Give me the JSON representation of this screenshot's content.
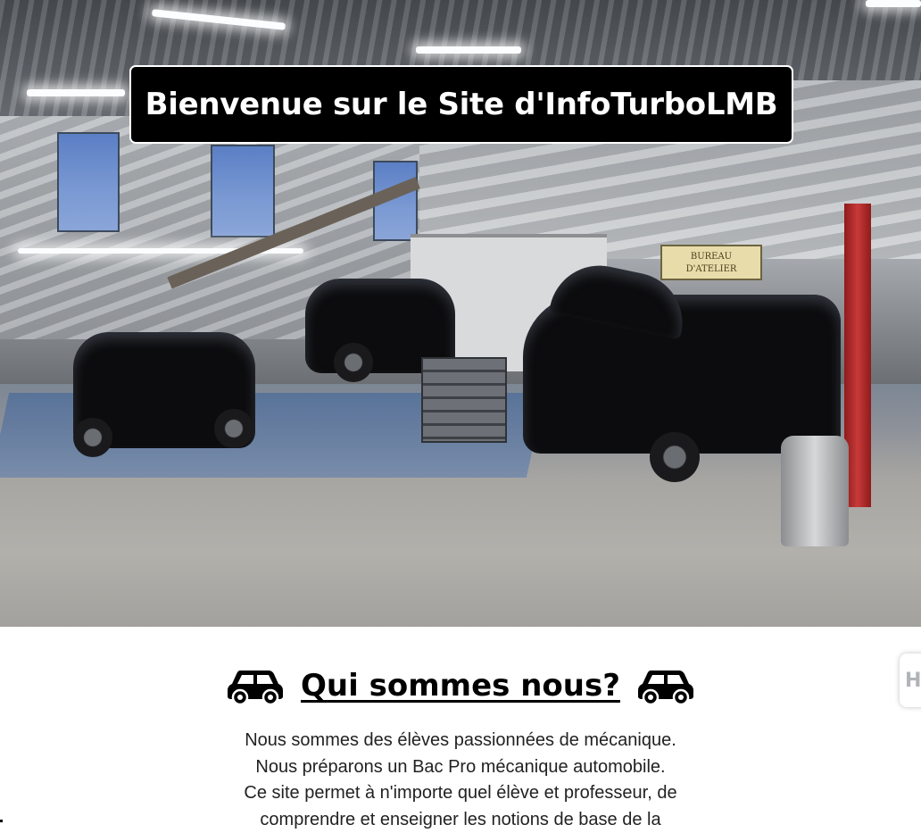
{
  "hero": {
    "title": "Bienvenue sur le Site d'InfoTurboLMB",
    "office_sign_line1": "BUREAU",
    "office_sign_line2": "D'ATELIER"
  },
  "about": {
    "heading": "Qui sommes nous?",
    "heading_icon": "car-icon",
    "paragraphs": [
      "Nous sommes des élèves passionnées de mécanique.",
      "Nous préparons un Bac Pro mécanique automobile.",
      "Ce site permet à n'importe quel élève et professeur, de",
      "comprendre et enseigner les notions de base de la"
    ]
  },
  "side_widget": {
    "icon": "widget-tab-icon",
    "glyph": "H"
  },
  "colors": {
    "title_bg": "#000000",
    "title_text": "#ffffff",
    "body_text": "#222222"
  }
}
